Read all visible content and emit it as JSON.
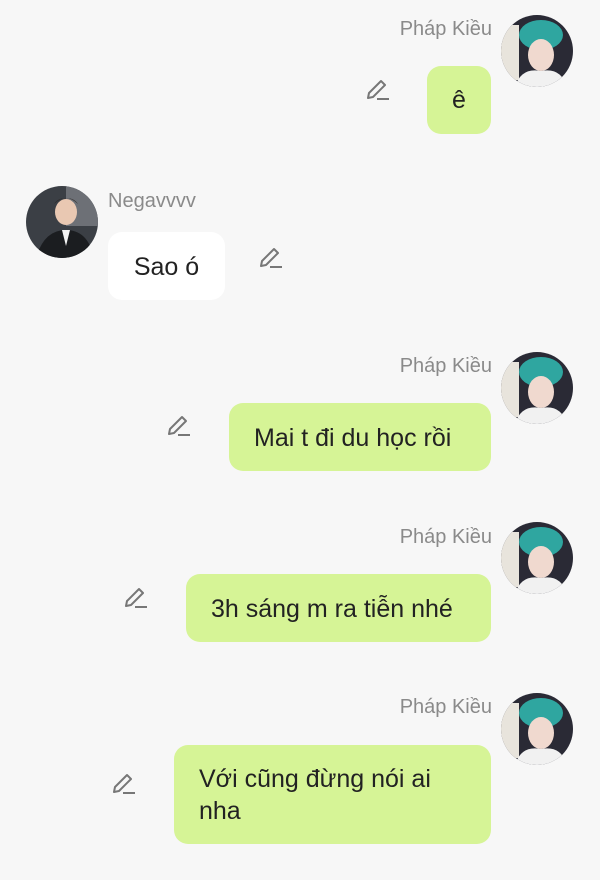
{
  "self_user": {
    "name": "Pháp Kiều"
  },
  "other_user": {
    "name": "Negavvvv"
  },
  "messages": [
    {
      "sender": "Pháp Kiều",
      "text": "ê"
    },
    {
      "sender": "Negavvvv",
      "text": "Sao ó"
    },
    {
      "sender": "Pháp Kiều",
      "text": "Mai t đi du học rồi"
    },
    {
      "sender": "Pháp Kiều",
      "text": "3h sáng m ra tiễn nhé"
    },
    {
      "sender": "Pháp Kiều",
      "text": "Với cũng đừng nói ai nha"
    }
  ],
  "icons": {
    "edit": "pencil-edit-icon"
  },
  "colors": {
    "outgoing_bubble": "#d6f496",
    "incoming_bubble": "#ffffff",
    "background": "#f7f7f7"
  }
}
